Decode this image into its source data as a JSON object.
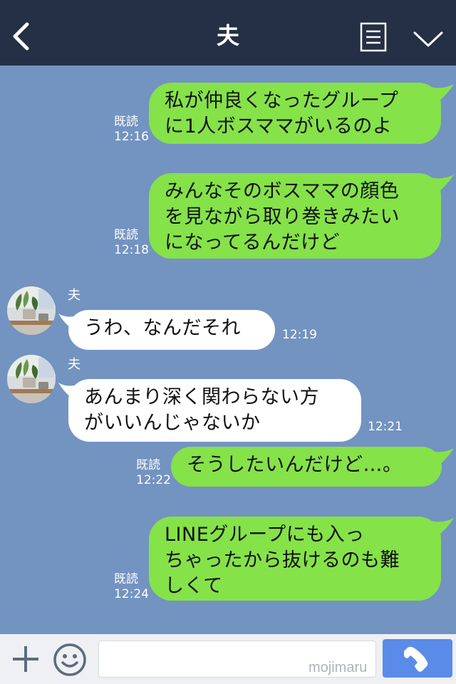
{
  "header": {
    "title": "夫",
    "back_icon": "chevron-left-icon",
    "menu_icon": "list-menu-icon",
    "collapse_icon": "chevron-down-icon",
    "background_color": "#252f45"
  },
  "chat": {
    "background_color": "#7393c1",
    "my_bubble_color": "#85e249",
    "their_bubble_color": "#ffffff",
    "messages": [
      {
        "from": "me",
        "text": "私が仲良くなったグループ\nに1人ボスママがいるのよ",
        "read": "既読",
        "time": "12:16"
      },
      {
        "from": "me",
        "text": "みんなそのボスママの顔色\nを見ながら取り巻きみたい\nになってるんだけど",
        "read": "既読",
        "time": "12:18"
      },
      {
        "from": "them",
        "sender": "夫",
        "text": "うわ、なんだそれ",
        "time": "12:19"
      },
      {
        "from": "them",
        "sender": "夫",
        "text": "あんまり深く関わらない方\nがいいんじゃないか",
        "time": "12:21"
      },
      {
        "from": "me",
        "text": "そうしたいんだけど…。",
        "read": "既読",
        "time": "12:22"
      },
      {
        "from": "me",
        "text": "LINEグループにも入っ\nちゃったから抜けるのも難\nしくて",
        "read": "既読",
        "time": "12:24"
      }
    ]
  },
  "bottom_bar": {
    "plus_icon": "plus-icon",
    "emoji_icon": "smiley-icon",
    "input_value": "",
    "input_placeholder": "",
    "watermark": "mojimaru",
    "call_icon": "phone-icon",
    "call_button_color": "#5b8be8"
  }
}
